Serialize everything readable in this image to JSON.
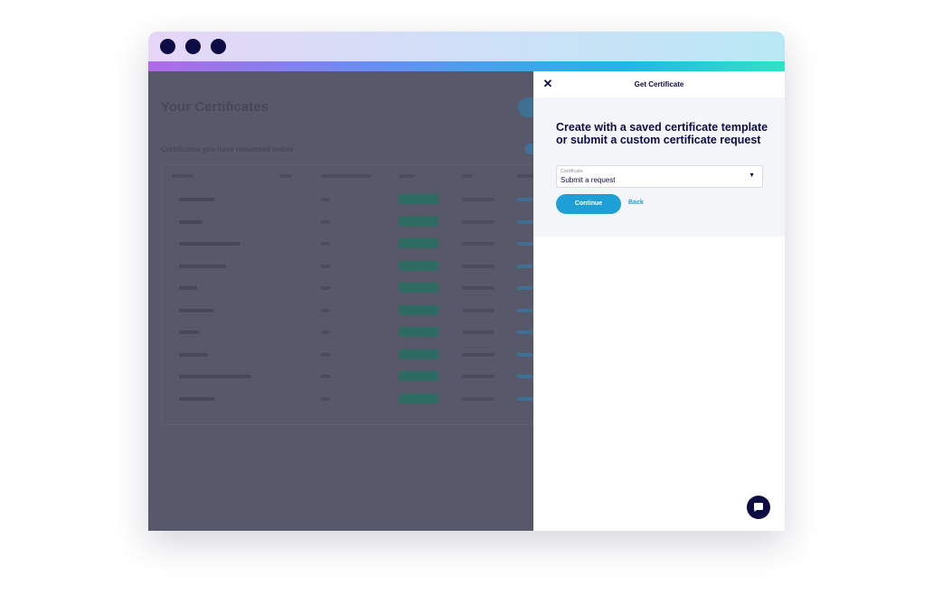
{
  "colors": {
    "navy": "#0d0c45",
    "accent_blue": "#1e9fd6",
    "backdrop": "#575869",
    "badge_green": "#2e6b62",
    "panel_body": "#f4f5f9"
  },
  "window": {
    "controls": [
      "window-dot",
      "window-dot",
      "window-dot"
    ]
  },
  "background_page": {
    "title": "Your Certificates",
    "subtitle": "Certificates you have requested online",
    "row_count": 10
  },
  "panel": {
    "close_icon": "close-icon",
    "title": "Get Certificate",
    "heading": "Create with a saved certificate template or submit a custom certificate request",
    "select": {
      "label": "Certificate",
      "value": "Submit a request",
      "icon": "caret-down-icon"
    },
    "continue_label": "Continue",
    "back_label": "Back"
  },
  "chat": {
    "icon": "chat-bubble-icon"
  }
}
